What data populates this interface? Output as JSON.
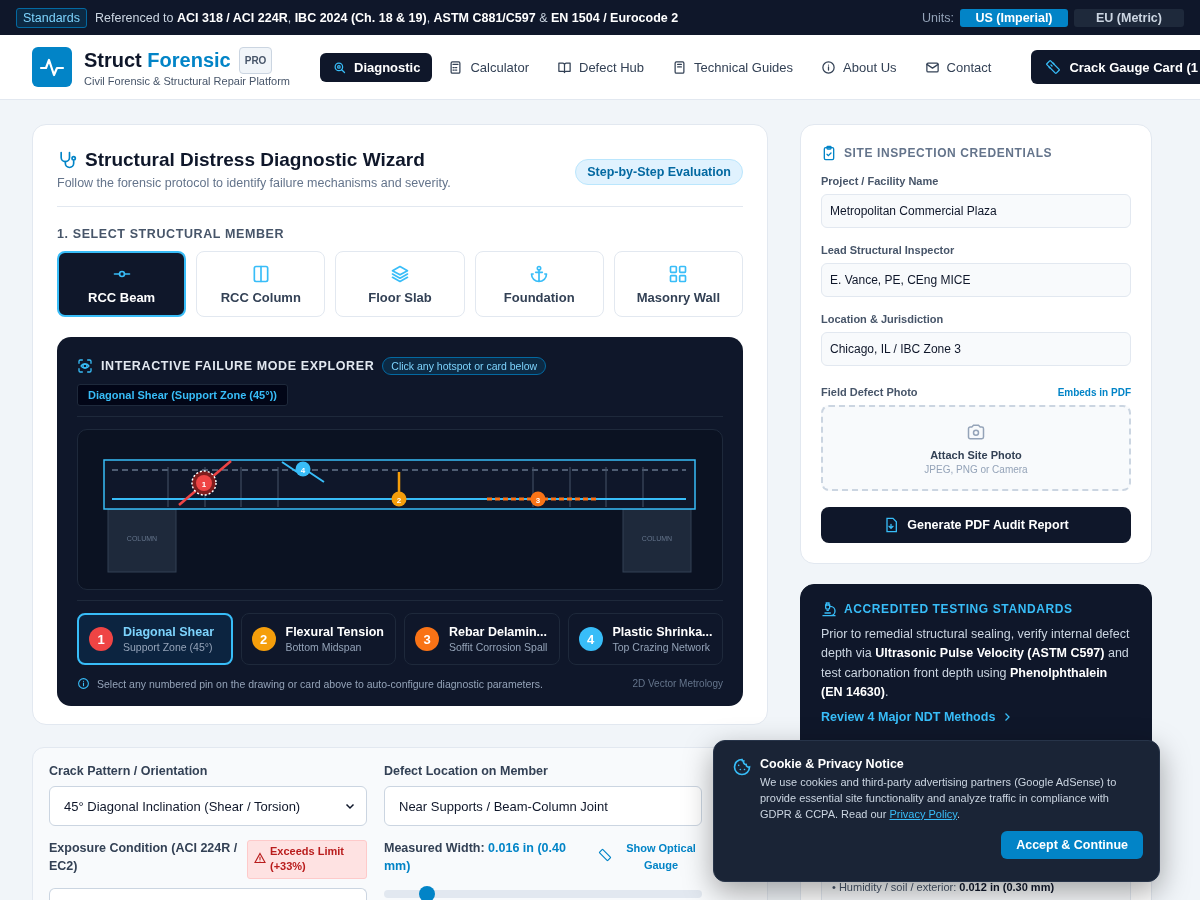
{
  "top_bar": {
    "badge": "Standards",
    "text": "Referenced to **ACI 318 / ACI 224R**, **IBC 2024 (Ch. 18 & 19)**, **ASTM C881/C597** & **EN 1504 / Eurocode 2**",
    "units_label": "Units:",
    "units": [
      {
        "label": "US (Imperial)",
        "selected": true
      },
      {
        "label": "EU (Metric)",
        "selected": false
      }
    ]
  },
  "header": {
    "brand_name": "Struct",
    "brand_accent": "Forensic",
    "badge": "PRO",
    "tagline": "Civil Forensic & Structural Repair Platform",
    "nav": [
      {
        "label": "Diagnostic",
        "selected": true
      },
      {
        "label": "Calculator",
        "selected": false
      },
      {
        "label": "Defect Hub",
        "selected": false
      },
      {
        "label": "Technical Guides",
        "selected": false
      },
      {
        "label": "About Us",
        "selected": false
      },
      {
        "label": "Contact",
        "selected": false
      }
    ],
    "cta": "Crack Gauge Card (1"
  },
  "wizard": {
    "title": "Structural Distress Diagnostic Wizard",
    "subtitle": "Follow the forensic protocol to identify failure mechanisms and severity.",
    "badge": "Step-by-Step Evaluation",
    "member_label": "1. SELECT STRUCTURAL MEMBER",
    "members": [
      {
        "label": "RCC Beam",
        "selected": true
      },
      {
        "label": "RCC Column",
        "selected": false
      },
      {
        "label": "Floor Slab",
        "selected": false
      },
      {
        "label": "Foundation",
        "selected": false
      },
      {
        "label": "Masonry Wall",
        "selected": false
      }
    ],
    "explorer": {
      "title": "INTERACTIVE FAILURE MODE EXPLORER",
      "hint": "Click any hotspot or card below",
      "active_label": "Diagonal Shear (Support Zone (45°))",
      "column_labels": [
        "COLUMN",
        "COLUMN"
      ],
      "pins": [
        {
          "number": "1",
          "kind": "diagonal",
          "color": "#ef4444",
          "selected": true
        },
        {
          "number": "2",
          "kind": "vertical",
          "color": "#f59e0b",
          "selected": false
        },
        {
          "number": "3",
          "kind": "spall",
          "color": "#f97316",
          "selected": false
        },
        {
          "number": "4",
          "kind": "crazing",
          "color": "#38bdf8",
          "selected": false
        }
      ],
      "modes": [
        {
          "number": "1",
          "title": "Diagonal Shear",
          "subtitle": "Support Zone (45°)",
          "color": "#ef4444",
          "selected": true
        },
        {
          "number": "2",
          "title": "Flexural Tension",
          "subtitle": "Bottom Midspan",
          "color": "#f59e0b",
          "selected": false
        },
        {
          "number": "3",
          "title": "Rebar Delamin...",
          "subtitle": "Soffit Corrosion Spall",
          "color": "#f97316",
          "selected": false
        },
        {
          "number": "4",
          "title": "Plastic Shrinka...",
          "subtitle": "Top Crazing Network",
          "color": "#38bdf8",
          "selected": false
        }
      ],
      "footer_note": "Select any numbered pin on the drawing or card above to auto-configure diagnostic parameters.",
      "footer_tag": "2D Vector Metrology"
    },
    "form": {
      "crack_pattern_label": "Crack Pattern / Orientation",
      "crack_pattern_value": "45° Diagonal Inclination (Shear / Torsion)",
      "location_label": "Defect Location on Member",
      "location_value": "Near Supports / Beam-Column Joint",
      "exposure_label": "Exposure Condition (ACI 224R / EC2)",
      "exposure_badge": "Exceeds Limit (+33%)",
      "width_label": "Measured Width:",
      "width_value": "0.016 in (0.40 mm)",
      "gauge_link": "Show Optical Gauge",
      "width_slider": {
        "level": 0.135
      }
    }
  },
  "credentials": {
    "title": "SITE INSPECTION CREDENTIALS",
    "fields": [
      {
        "label": "Project / Facility Name",
        "value": "Metropolitan Commercial Plaza"
      },
      {
        "label": "Lead Structural Inspector",
        "value": "E. Vance, PE, CEng MICE"
      },
      {
        "label": "Location & Jurisdiction",
        "value": "Chicago, IL / IBC Zone 3"
      }
    ],
    "photo_label": "Field Defect Photo",
    "photo_note": "Embeds in PDF",
    "photo_title": "Attach Site Photo",
    "photo_hint": "JPEG, PNG or Camera",
    "button": "Generate PDF Audit Report"
  },
  "testing": {
    "title": "ACCREDITED TESTING STANDARDS",
    "text": "Prior to remedial structural sealing, verify internal defect depth via **Ultrasonic Pulse Velocity (ASTM C597)** and test carbonation front depth using **Phenolphthalein (EN 14630)**.",
    "link": "Review 4 Major NDT Methods"
  },
  "limits": {
    "item": "• Humidity / soil / exterior: **0.012 in (0.30 mm)**"
  },
  "cookie": {
    "title": "Cookie & Privacy Notice",
    "text_before": "We use cookies and third-party advertising partners (Google AdSense) to provide essential site functionality and analyze traffic in compliance with GDPR & CCPA. Read our ",
    "link": "Privacy Policy",
    "text_after": ".",
    "button": "Accept & Continue"
  }
}
